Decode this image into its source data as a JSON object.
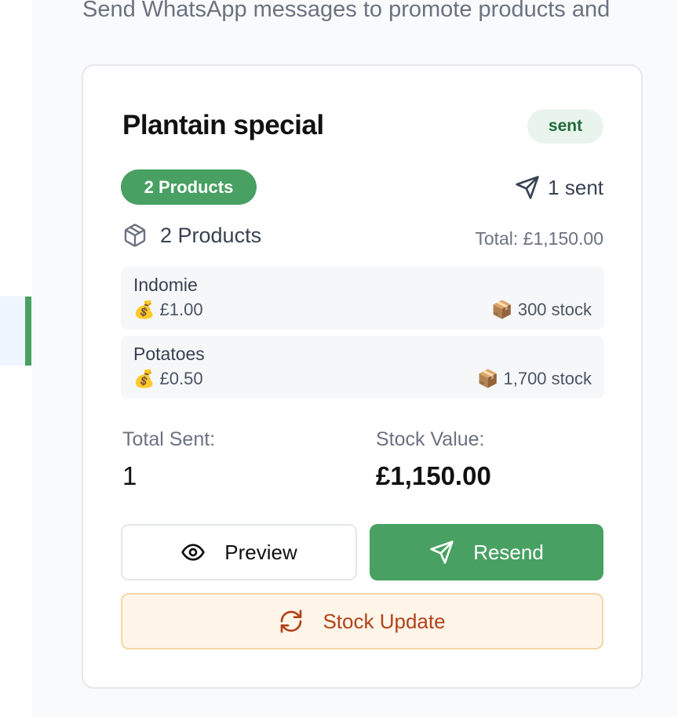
{
  "page": {
    "subtitle": "Send WhatsApp messages to promote products and"
  },
  "campaign": {
    "title": "Plantain special",
    "status": "sent",
    "products_badge": "2 Products",
    "sent_count": "1 sent",
    "products_header": "2 Products",
    "total": "Total: £1,150.00",
    "products": [
      {
        "name": "Indomie",
        "price": "£1.00",
        "stock": "300 stock",
        "price_emoji": "💰",
        "stock_emoji": "📦"
      },
      {
        "name": "Potatoes",
        "price": "£0.50",
        "stock": "1,700 stock",
        "price_emoji": "💰",
        "stock_emoji": "📦"
      }
    ],
    "stats": {
      "total_sent_label": "Total Sent:",
      "total_sent_value": "1",
      "stock_value_label": "Stock Value:",
      "stock_value_value": "£1,150.00"
    },
    "actions": {
      "preview_label": "Preview",
      "resend_label": "Resend",
      "stock_update_label": "Stock Update"
    }
  },
  "icons": {
    "send": "send-icon",
    "package": "package-icon",
    "eye": "eye-icon",
    "refresh": "refresh-icon"
  },
  "colors": {
    "accent_green": "#48a062",
    "status_bg": "#e9f5ec",
    "status_text": "#1f6b3a",
    "stock_update_bg": "#fff5e9",
    "stock_update_text": "#b2421a"
  }
}
